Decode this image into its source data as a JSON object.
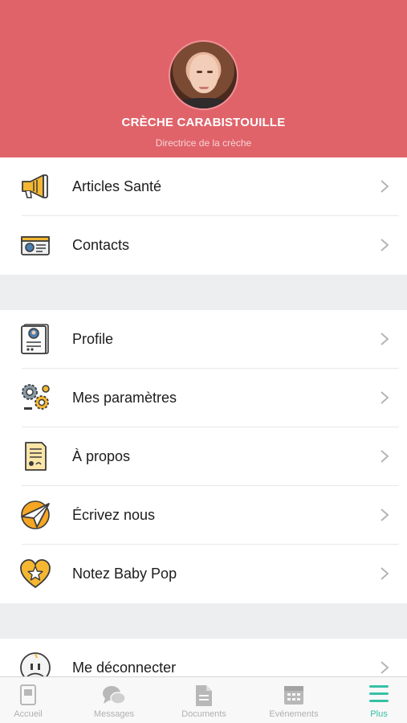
{
  "header": {
    "org_name": "CRÈCHE CARABISTOUILLE",
    "role": "Directrice de la crèche"
  },
  "menu_group_1": [
    {
      "label": "Articles Santé",
      "icon": "megaphone-icon"
    },
    {
      "label": "Contacts",
      "icon": "contact-card-icon"
    }
  ],
  "menu_group_2": [
    {
      "label": "Profile",
      "icon": "profile-document-icon"
    },
    {
      "label": "Mes paramètres",
      "icon": "gears-icon"
    },
    {
      "label": "À propos",
      "icon": "certificate-icon"
    },
    {
      "label": "Écrivez nous",
      "icon": "paper-plane-icon"
    },
    {
      "label": "Notez Baby Pop",
      "icon": "heart-star-icon"
    }
  ],
  "menu_group_3": [
    {
      "label": "Me déconnecter",
      "icon": "logout-face-icon"
    }
  ],
  "tabbar": [
    {
      "label": "Accueil",
      "icon": "home-icon"
    },
    {
      "label": "Messages",
      "icon": "chat-bubbles-icon"
    },
    {
      "label": "Documents",
      "icon": "document-icon"
    },
    {
      "label": "Evénements",
      "icon": "calendar-icon"
    },
    {
      "label": "Plus",
      "icon": "menu-icon",
      "active": true
    }
  ],
  "colors": {
    "header_bg": "#e0636a",
    "accent": "#35c1a6",
    "icon_yellow": "#f5b731",
    "separator_band": "#eceeef"
  }
}
